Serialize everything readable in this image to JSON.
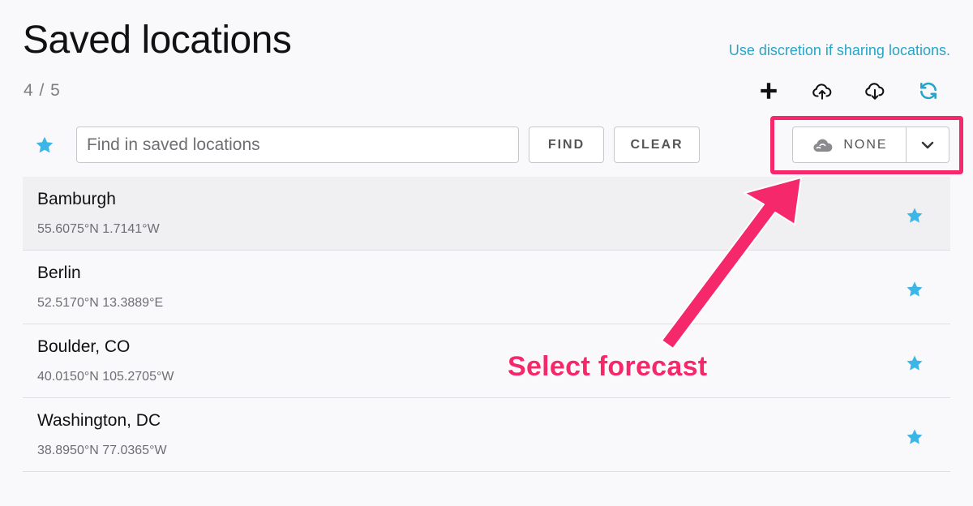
{
  "header": {
    "title": "Saved locations",
    "counter": "4 / 5",
    "notice": "Use discretion if sharing locations."
  },
  "toolbar": {
    "icons": [
      "plus-icon",
      "cloud-upload-icon",
      "cloud-download-icon",
      "refresh-icon"
    ]
  },
  "search": {
    "placeholder": "Find in saved locations",
    "value": "",
    "find_label": "FIND",
    "clear_label": "CLEAR"
  },
  "forecast": {
    "selected": "NONE",
    "icon": "cloud-icon"
  },
  "locations": [
    {
      "name": "Bamburgh",
      "coords": "55.6075°N 1.7141°W",
      "favorite": true
    },
    {
      "name": "Berlin",
      "coords": "52.5170°N 13.3889°E",
      "favorite": true
    },
    {
      "name": "Boulder, CO",
      "coords": "40.0150°N 105.2705°W",
      "favorite": true
    },
    {
      "name": "Washington, DC",
      "coords": "38.8950°N 77.0365°W",
      "favorite": true
    }
  ],
  "annotation": {
    "label": "Select forecast"
  },
  "colors": {
    "accent": "#27a4c7",
    "star": "#3bb6e6",
    "annotation": "#f5286b"
  }
}
